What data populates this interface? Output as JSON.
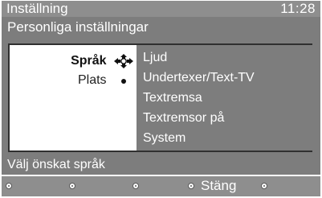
{
  "header": {
    "title": "Inställning",
    "clock": "11:28"
  },
  "subheader": {
    "title": "Personliga inställningar"
  },
  "menu": {
    "left_items": [
      {
        "label": "Språk",
        "active": true,
        "icon": "navigation-cross-icon"
      },
      {
        "label": "Plats",
        "active": false,
        "icon": "bullet-dot-icon"
      }
    ],
    "right_items": [
      {
        "label": "Ljud"
      },
      {
        "label": "Undertexer/Text-TV"
      },
      {
        "label": "Textremsa"
      },
      {
        "label": "Textremsor på"
      },
      {
        "label": "System"
      }
    ]
  },
  "hint": {
    "text": "Välj önskat språk"
  },
  "footer": {
    "keys": [
      {
        "label": "",
        "icon": "remote-button-icon"
      },
      {
        "label": "",
        "icon": "remote-button-icon"
      },
      {
        "label": "",
        "icon": "remote-button-icon"
      },
      {
        "label": "Stäng",
        "icon": "remote-button-icon"
      },
      {
        "label": "",
        "icon": "remote-button-icon"
      }
    ]
  },
  "colors": {
    "title_bar": "#8e8e8e",
    "panel": "#7d7d7d",
    "menu_background": "#ffffff",
    "text_light": "#ffffff",
    "text_dark": "#222222"
  }
}
